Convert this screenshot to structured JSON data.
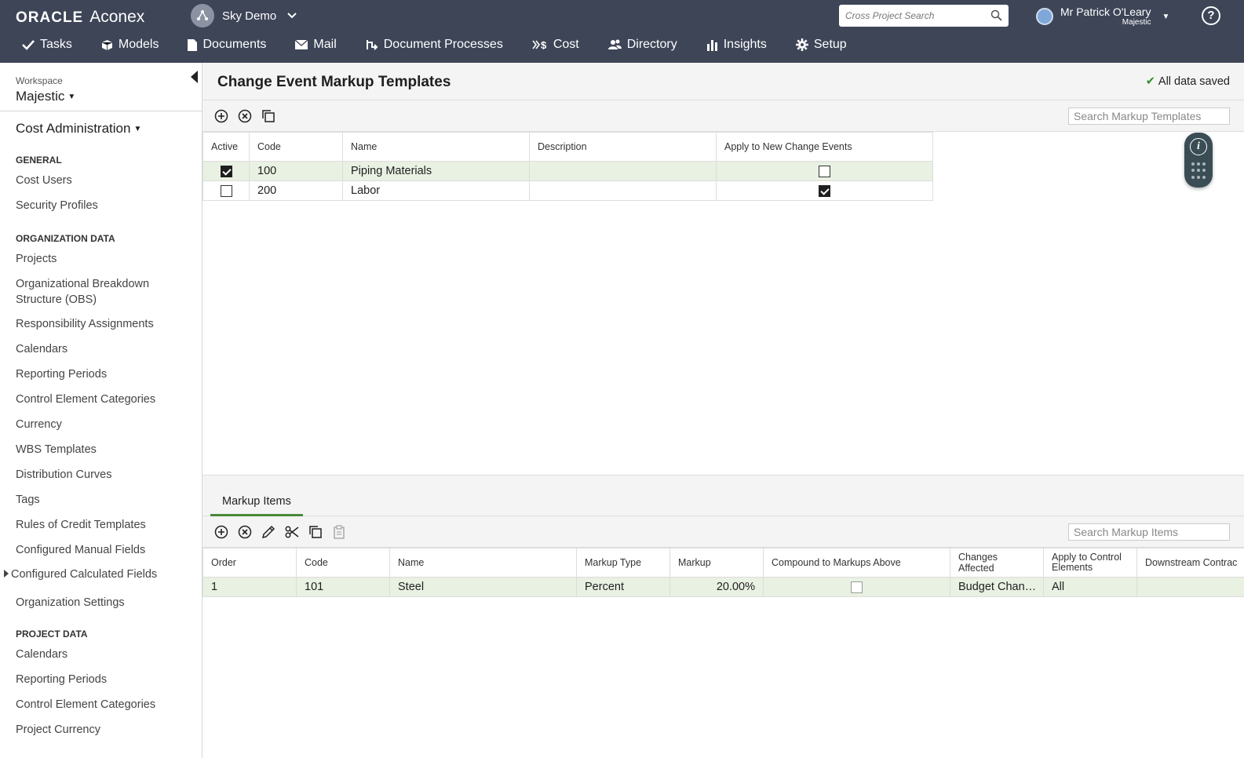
{
  "header": {
    "brand_oracle": "ORACLE",
    "brand_product": "Aconex",
    "project_name": "Sky Demo",
    "search_placeholder": "Cross Project Search",
    "user_name": "Mr Patrick O'Leary",
    "user_org": "Majestic",
    "help": "?"
  },
  "nav": [
    {
      "label": "Tasks",
      "icon": "check-icon"
    },
    {
      "label": "Models",
      "icon": "cube-icon"
    },
    {
      "label": "Documents",
      "icon": "document-icon"
    },
    {
      "label": "Mail",
      "icon": "envelope-icon"
    },
    {
      "label": "Document Processes",
      "icon": "workflow-icon"
    },
    {
      "label": "Cost",
      "icon": "cost-icon"
    },
    {
      "label": "Directory",
      "icon": "people-icon"
    },
    {
      "label": "Insights",
      "icon": "bar-chart-icon"
    },
    {
      "label": "Setup",
      "icon": "gear-icon"
    }
  ],
  "sidebar": {
    "workspace_label": "Workspace",
    "workspace_name": "Majestic",
    "module": "Cost Administration",
    "general_heading": "GENERAL",
    "general_items": [
      "Cost Users",
      "Security Profiles"
    ],
    "org_heading": "ORGANIZATION DATA",
    "org_items": [
      "Projects",
      "Organizational Breakdown Structure (OBS)",
      "Responsibility Assignments",
      "Calendars",
      "Reporting Periods",
      "Control Element Categories",
      "Currency",
      "WBS Templates",
      "Distribution Curves",
      "Tags",
      "Rules of Credit Templates",
      "Configured Manual Fields",
      "Configured Calculated Fields",
      "Organization Settings"
    ],
    "project_heading": "PROJECT DATA",
    "project_items": [
      "Calendars",
      "Reporting Periods",
      "Control Element Categories",
      "Project Currency"
    ]
  },
  "main": {
    "title": "Change Event Markup Templates",
    "save_status": "All data saved",
    "template_search_placeholder": "Search Markup Templates",
    "template_columns": [
      "Active",
      "Code",
      "Name",
      "Description",
      "Apply to New Change Events"
    ],
    "template_rows": [
      {
        "active": true,
        "code": "100",
        "name": "Piping Materials",
        "description": "",
        "apply_new": false
      },
      {
        "active": false,
        "code": "200",
        "name": "Labor",
        "description": "",
        "apply_new": true
      }
    ],
    "items_tab": "Markup Items",
    "items_search_placeholder": "Search Markup Items",
    "item_columns": [
      "Order",
      "Code",
      "Name",
      "Markup Type",
      "Markup",
      "Compound to Markups Above",
      "Changes Affected",
      "Apply to Control Elements",
      "Downstream Contrac"
    ],
    "item_rows": [
      {
        "order": "1",
        "code": "101",
        "name": "Steel",
        "markup_type": "Percent",
        "markup": "20.00%",
        "compound": false,
        "changes_affected": "Budget Chan…",
        "apply_control": "All",
        "downstream": ""
      }
    ]
  }
}
